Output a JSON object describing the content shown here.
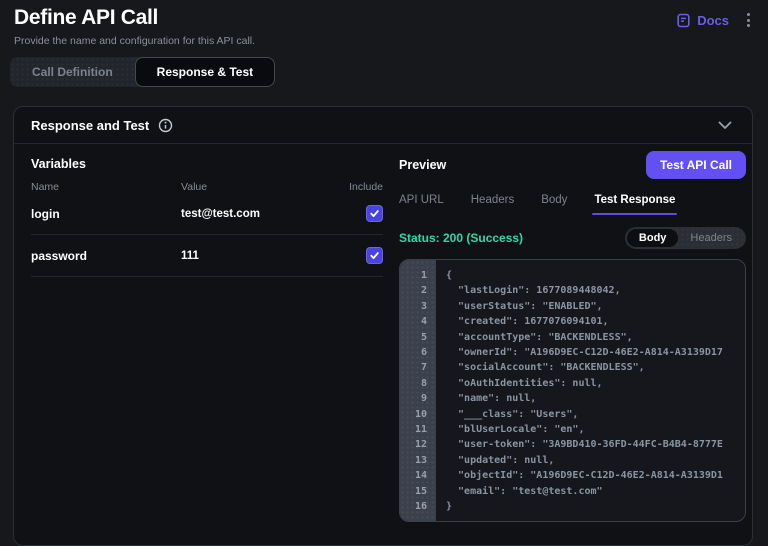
{
  "page": {
    "title": "Define API Call",
    "subtitle": "Provide the name and configuration for this API call."
  },
  "header": {
    "docs_label": "Docs"
  },
  "main_tabs": [
    {
      "label": "Call Definition",
      "active": false
    },
    {
      "label": "Response & Test",
      "active": true
    }
  ],
  "panel": {
    "title": "Response and Test"
  },
  "variables": {
    "heading": "Variables",
    "columns": {
      "name": "Name",
      "value": "Value",
      "include": "Include"
    },
    "rows": [
      {
        "name": "login",
        "value": "test@test.com",
        "include": true
      },
      {
        "name": "password",
        "value": "111",
        "include": true
      }
    ]
  },
  "preview": {
    "heading": "Preview",
    "test_button_label": "Test API Call",
    "tabs": [
      {
        "label": "API URL",
        "active": false
      },
      {
        "label": "Headers",
        "active": false
      },
      {
        "label": "Body",
        "active": false
      },
      {
        "label": "Test Response",
        "active": true
      }
    ],
    "status_text": "Status: 200 (Success)",
    "toggle": [
      {
        "label": "Body",
        "active": true
      },
      {
        "label": "Headers",
        "active": false
      }
    ],
    "code_lines": [
      "{",
      "  \"lastLogin\": 1677089448042,",
      "  \"userStatus\": \"ENABLED\",",
      "  \"created\": 1677076094101,",
      "  \"accountType\": \"BACKENDLESS\",",
      "  \"ownerId\": \"A196D9EC-C12D-46E2-A814-A3139D17",
      "  \"socialAccount\": \"BACKENDLESS\",",
      "  \"oAuthIdentities\": null,",
      "  \"name\": null,",
      "  \"___class\": \"Users\",",
      "  \"blUserLocale\": \"en\",",
      "  \"user-token\": \"3A9BD410-36FD-44FC-B4B4-8777E",
      "  \"updated\": null,",
      "  \"objectId\": \"A196D9EC-C12D-46E2-A814-A3139D1",
      "  \"email\": \"test@test.com\"",
      "}"
    ]
  },
  "colors": {
    "accent_purple": "#6350F2",
    "docs_purple": "#6C5CE7",
    "checkbox_blue": "#4B43E0",
    "status_teal": "#2ED9A4"
  },
  "icons": {
    "docs": "document-icon",
    "menu": "kebab-menu-icon",
    "info": "info-circle-icon",
    "collapse": "chevron-down-icon",
    "check": "checkmark-icon"
  }
}
